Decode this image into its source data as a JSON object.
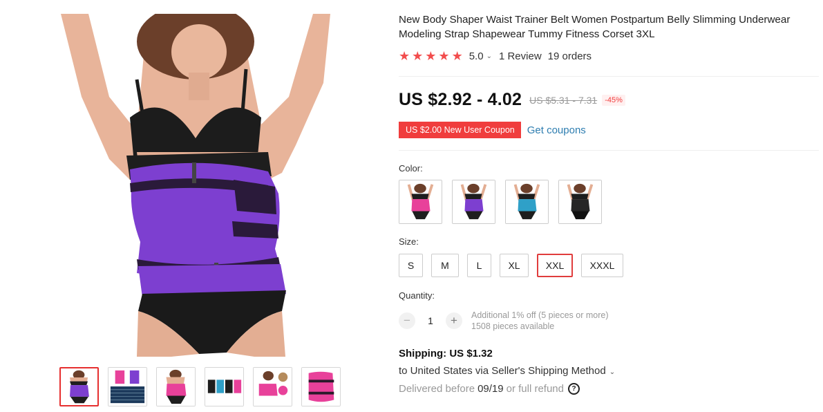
{
  "product": {
    "title": "New Body Shaper Waist Trainer Belt Women Postpartum Belly Slimming Underwear Modeling Strap Shapewear Tummy Fitness Corset 3XL",
    "rating": "5.0",
    "reviews": "1 Review",
    "orders": "19 orders",
    "price": "US $2.92 - 4.02",
    "old_price": "US $5.31 - 7.31",
    "discount": "-45%",
    "coupon": "US $2.00 New User Coupon",
    "get_coupons": "Get coupons"
  },
  "options": {
    "color_label": "Color:",
    "colors": [
      {
        "name": "pink",
        "hex": "#e8419a"
      },
      {
        "name": "purple",
        "hex": "#7d3fd0"
      },
      {
        "name": "blue",
        "hex": "#2fa0c8"
      },
      {
        "name": "black",
        "hex": "#1f1f1f"
      }
    ],
    "size_label": "Size:",
    "sizes": [
      "S",
      "M",
      "L",
      "XL",
      "XXL",
      "XXXL"
    ],
    "selected_size": "XXL"
  },
  "quantity": {
    "label": "Quantity:",
    "value": "1",
    "minus": "−",
    "plus": "+",
    "additional": "Additional 1% off (5 pieces or more)",
    "available": "1508 pieces available"
  },
  "shipping": {
    "cost_label": "Shipping: US $1.32",
    "via": "to United States via Seller's Shipping Method",
    "delivered_prefix": "Delivered before",
    "date": "09/19",
    "delivered_suffix": "or full refund",
    "help": "?"
  },
  "colors": {
    "accent": "#f03d3d",
    "link": "#2d7db0",
    "main_garment": "#7d3fd0"
  },
  "gallery": {
    "thumbnails": [
      "purple",
      "size-chart",
      "pink",
      "multi",
      "pink-zipper",
      "pink-belt"
    ],
    "active": 0
  }
}
